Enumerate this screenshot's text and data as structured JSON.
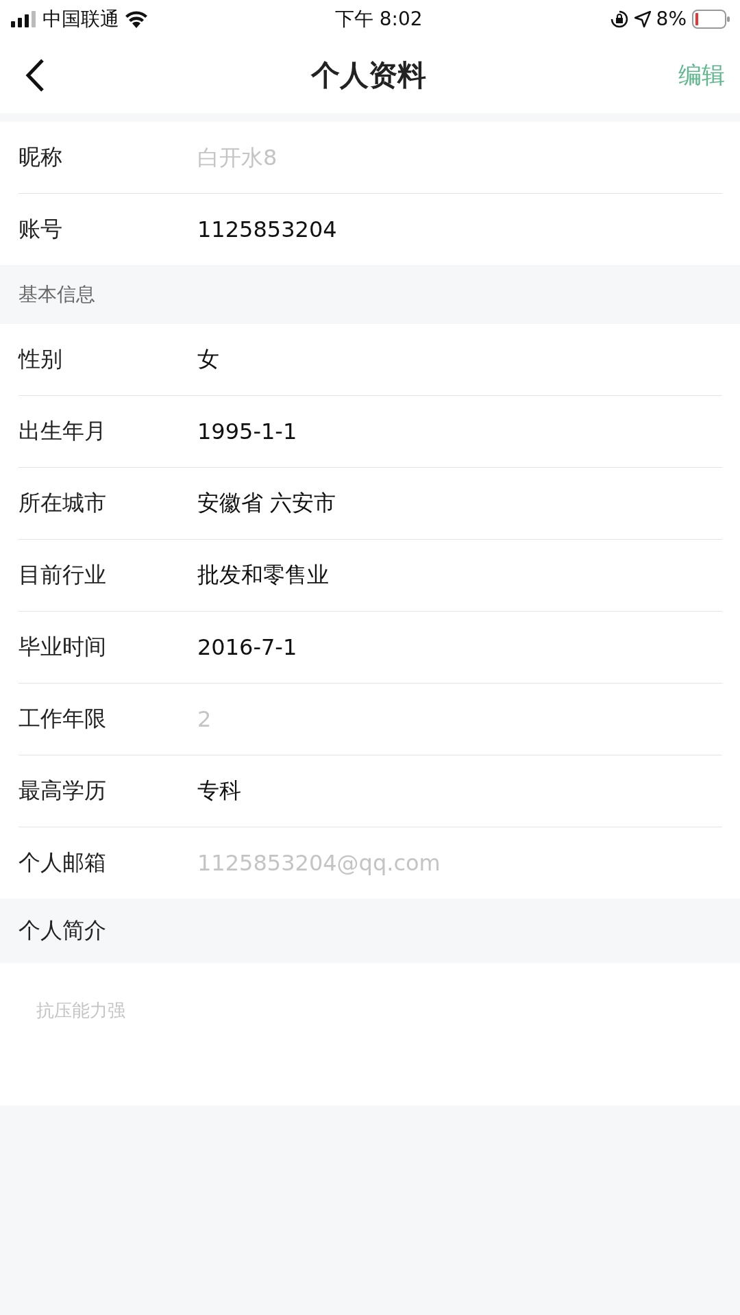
{
  "status_bar": {
    "carrier": "中国联通",
    "time": "下午 8:02",
    "battery": "8%"
  },
  "nav": {
    "title": "个人资料",
    "action": "编辑"
  },
  "account": [
    {
      "label": "昵称",
      "placeholder": "白开水8"
    },
    {
      "label": "账号",
      "value": "1125853204"
    }
  ],
  "basic_info": {
    "title": "基本信息",
    "rows": [
      {
        "label": "性别",
        "value": "女"
      },
      {
        "label": "出生年月",
        "value": "1995-1-1"
      },
      {
        "label": "所在城市",
        "value": "安徽省 六安市"
      },
      {
        "label": "目前行业",
        "value": "批发和零售业"
      },
      {
        "label": "毕业时间",
        "value": "2016-7-1"
      },
      {
        "label": "工作年限",
        "placeholder": "2"
      },
      {
        "label": "最高学历",
        "value": "专科"
      },
      {
        "label": "个人邮箱",
        "placeholder": "1125853204@qq.com"
      }
    ]
  },
  "intro": {
    "title": "个人简介",
    "placeholder": "抗压能力强"
  }
}
